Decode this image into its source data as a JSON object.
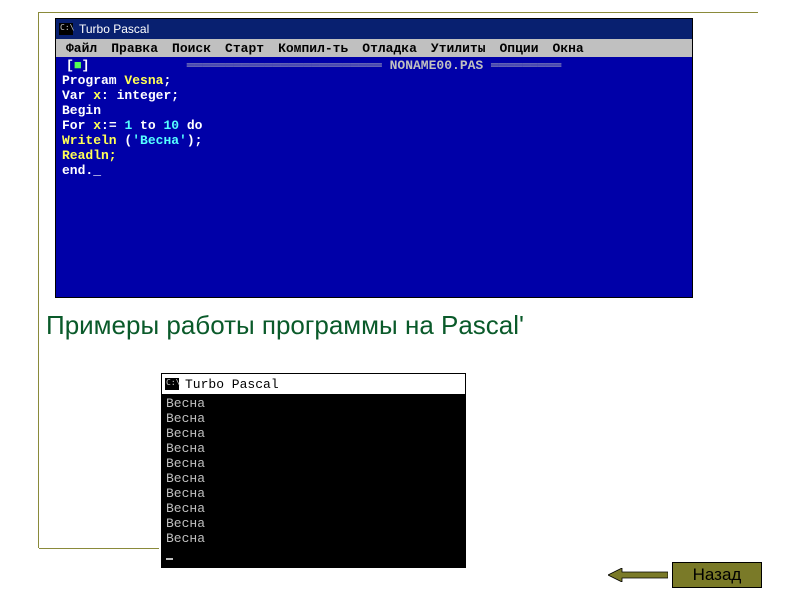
{
  "editor": {
    "title": "Turbo Pascal",
    "menu": [
      "Файл",
      "Правка",
      "Поиск",
      "Старт",
      "Компил-ть",
      "Отладка",
      "Утилиты",
      "Опции",
      "Окна"
    ],
    "filename": "NONAME00.PAS",
    "close_marker_l": "[",
    "close_marker_m": "■",
    "close_marker_r": "]",
    "code": {
      "l1a": "Program ",
      "l1b": "Vesna",
      "l1c": ";",
      "l2a": "Var ",
      "l2b": "x",
      "l2c": ": integer;",
      "l3": "Begin",
      "l4a": "For ",
      "l4b": "x",
      "l4c": ":= ",
      "l4d": "1",
      "l4e": " to ",
      "l4f": "10",
      "l4g": " do",
      "l5a": "Writeln ",
      "l5b": "(",
      "l5c": "'Весна'",
      "l5d": ")",
      "l5e": ";",
      "l6": "Readln;",
      "l7": "end._"
    }
  },
  "heading": "Примеры работы программы на Pascal'",
  "output": {
    "title": "Turbo Pascal",
    "lines": [
      "Весна",
      "Весна",
      "Весна",
      "Весна",
      "Весна",
      "Весна",
      "Весна",
      "Весна",
      "Весна",
      "Весна"
    ]
  },
  "back_label": "Назад"
}
